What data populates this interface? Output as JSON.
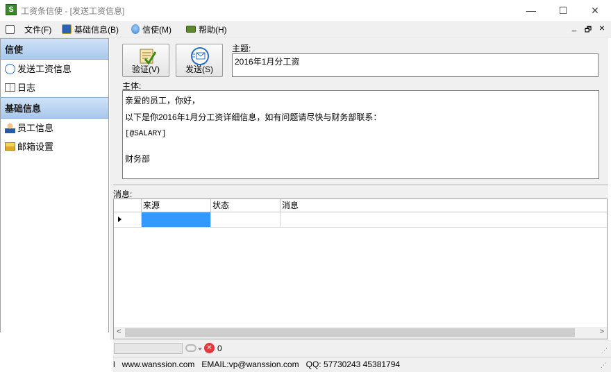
{
  "window": {
    "title": "工资条信使 - [发送工资信息]",
    "app_icon_letter": "S",
    "minimize_glyph": "—",
    "maximize_glyph": "☐",
    "close_glyph": "✕"
  },
  "menubar": {
    "items": [
      {
        "label": "文件(F)",
        "icon": "file-icon"
      },
      {
        "label": "基础信息(B)",
        "icon": "book-icon"
      },
      {
        "label": "信使(M)",
        "icon": "bulb-icon"
      },
      {
        "label": "帮助(H)",
        "icon": "help-book-icon"
      }
    ],
    "mdi_min": "_",
    "mdi_restore": "🗗",
    "mdi_close": "×"
  },
  "sidebar": {
    "groups": [
      {
        "title": "信使",
        "items": [
          {
            "label": "发送工资信息",
            "icon": "send-salary-icon"
          },
          {
            "label": "日志",
            "icon": "log-book-icon"
          }
        ]
      },
      {
        "title": "基础信息",
        "items": [
          {
            "label": "员工信息",
            "icon": "employee-icon"
          },
          {
            "label": "邮箱设置",
            "icon": "mailbox-icon"
          }
        ]
      }
    ]
  },
  "form": {
    "verify_label": "验证(V)",
    "send_label": "发送(S)",
    "subject_label": "主题:",
    "subject_value": "2016年1月分工资",
    "body_label": "主体:",
    "body_lines": [
      "亲爱的员工，你好，",
      "以下是你2016年1月分工资详细信息，如有问题请尽快与财务部联系：",
      "[@SALARY]",
      "",
      "财务部"
    ]
  },
  "messages": {
    "label": "消息:",
    "columns": [
      "来源",
      "状态",
      "消息"
    ],
    "rows": [
      {
        "source": "",
        "status": "",
        "message": ""
      }
    ],
    "scroll_left": "<",
    "scroll_right": ">"
  },
  "status": {
    "error_count": "0",
    "footer_text": "l   www.wanssion.com   EMAIL:vp@wanssion.com   QQ: 57730243 45381794"
  },
  "colors": {
    "selected_cell": "#3399ff",
    "sidebar_header": "#b7d1ef",
    "app_icon": "#3a8a2a"
  }
}
